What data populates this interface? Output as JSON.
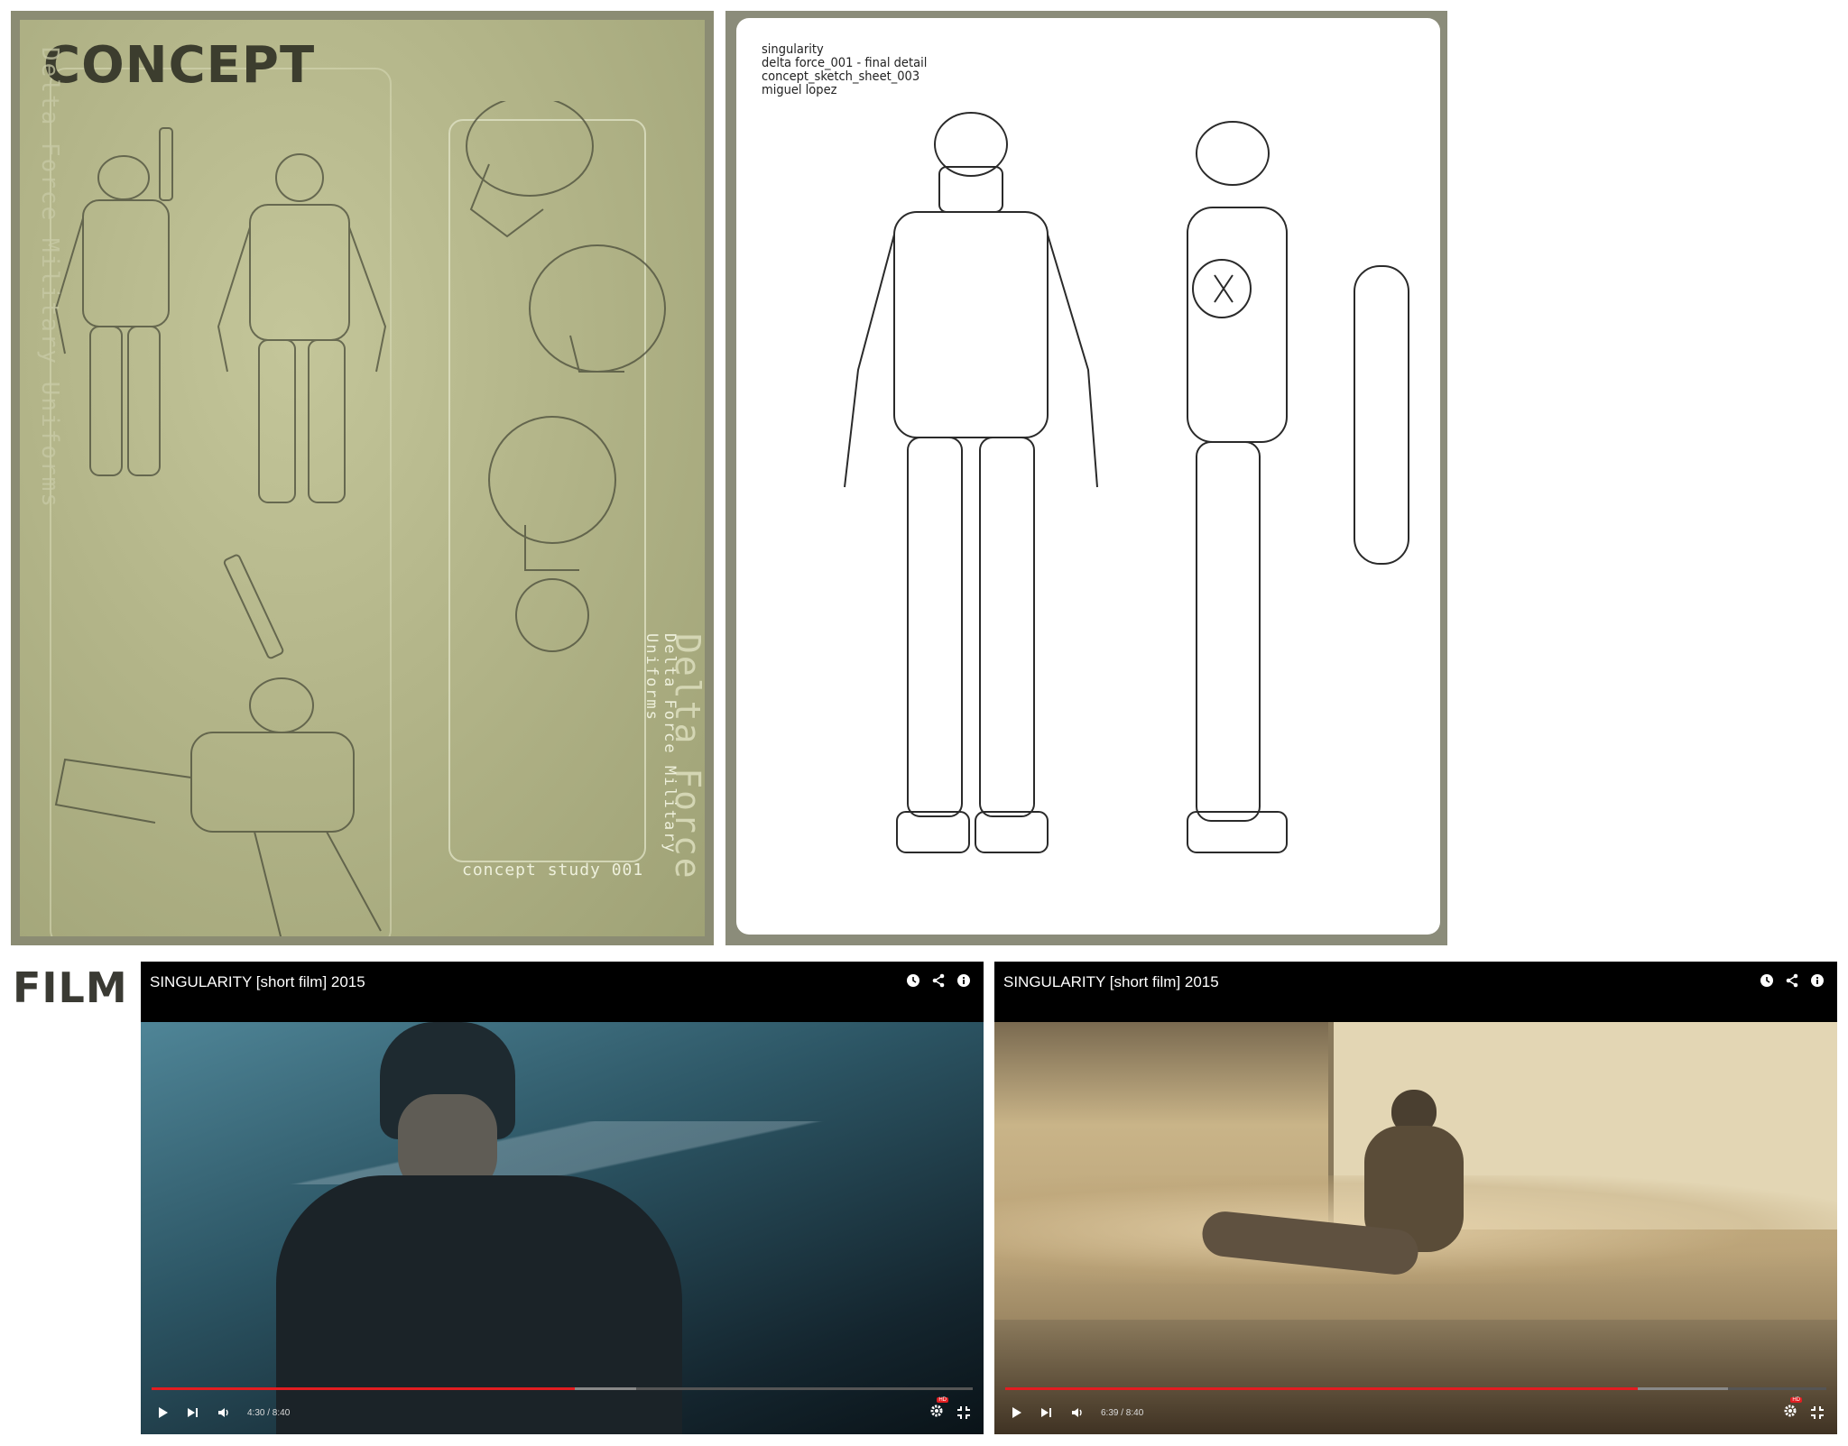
{
  "concept_section": {
    "heading": "CONCEPT",
    "panel1": {
      "vertical_text_left": "Delta Force Military Uniforms",
      "vertical_text_big": "Delta Force",
      "vertical_text_small": "Delta Force Military Uniforms",
      "caption": "concept study 001"
    },
    "panel2": {
      "lines": [
        "singularity",
        "delta force_001 - final detail",
        "concept_sketch_sheet_003",
        "miguel lopez"
      ]
    }
  },
  "film_section": {
    "heading": "FILM",
    "players": [
      {
        "title": "SINGULARITY [short film] 2015",
        "time": "4:30 / 8:40",
        "progress_played": 0.515,
        "progress_buffered": 0.59,
        "top_icons": [
          "clock-icon",
          "share-icon",
          "info-icon"
        ],
        "hd_label": "HD",
        "colors": {
          "frame_top": "#3f6e7e",
          "frame_bottom": "#0e1a22"
        }
      },
      {
        "title": "SINGULARITY [short film] 2015",
        "time": "6:39 / 8:40",
        "progress_played": 0.77,
        "progress_buffered": 0.88,
        "top_icons": [
          "clock-icon",
          "share-icon",
          "info-icon"
        ],
        "hd_label": "HD",
        "colors": {
          "frame_top": "#d8c8a2",
          "frame_bottom": "#5b4a33"
        }
      }
    ]
  },
  "colors": {
    "panel1_bg": "#a8aa7e",
    "panel_border": "#8b8c73",
    "progress_red": "#e21d21"
  }
}
